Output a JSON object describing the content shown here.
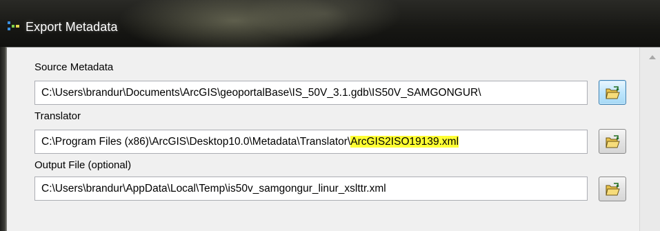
{
  "window": {
    "title": "Export Metadata"
  },
  "form": {
    "source": {
      "label": "Source Metadata",
      "value": "C:\\Users\\brandur\\Documents\\ArcGIS\\geoportalBase\\IS_50V_3.1.gdb\\IS50V_SAMGONGUR\\"
    },
    "translator": {
      "label": "Translator",
      "value_prefix": "C:\\Program Files (x86)\\ArcGIS\\Desktop10.0\\Metadata\\Translator\\",
      "value_highlight": "ArcGIS2ISO19139.xml"
    },
    "output": {
      "label": "Output File (optional)",
      "value": "C:\\Users\\brandur\\AppData\\Local\\Temp\\is50v_samgongur_linur_xslttr.xml"
    }
  },
  "icons": {
    "window": "export-metadata-icon",
    "browse": "open-folder-icon",
    "scroll": "scroll-up-arrow-icon"
  },
  "colors": {
    "highlight": "#ffff33",
    "focused_button": "#bee6fd",
    "folder": "#e8c24a"
  }
}
